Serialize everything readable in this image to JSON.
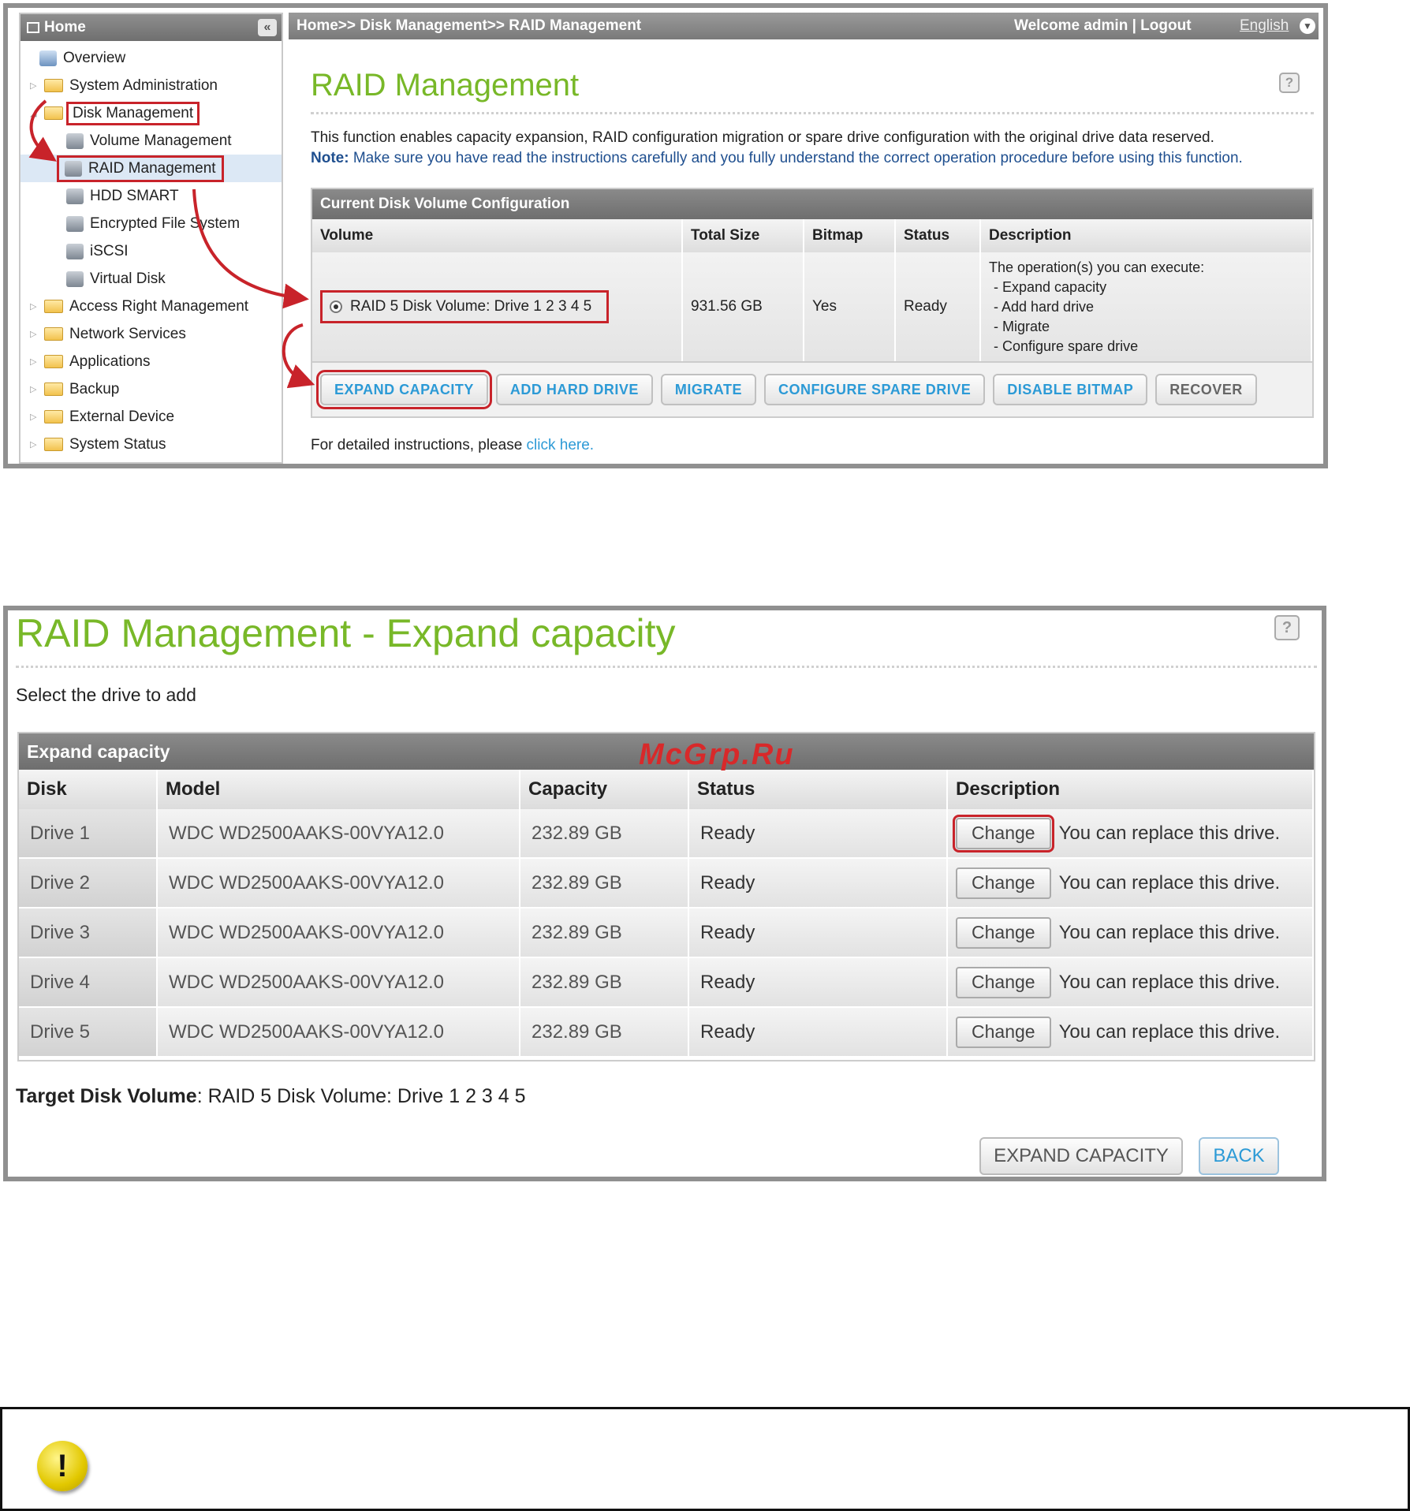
{
  "panel1": {
    "sidebar": {
      "home": "Home",
      "collapse": "«",
      "items": [
        {
          "label": "Overview"
        },
        {
          "label": "System Administration"
        },
        {
          "label": "Disk Management"
        },
        {
          "label": "Volume Management"
        },
        {
          "label": "RAID Management"
        },
        {
          "label": "HDD SMART"
        },
        {
          "label": "Encrypted File System"
        },
        {
          "label": "iSCSI"
        },
        {
          "label": "Virtual Disk"
        },
        {
          "label": "Access Right Management"
        },
        {
          "label": "Network Services"
        },
        {
          "label": "Applications"
        },
        {
          "label": "Backup"
        },
        {
          "label": "External Device"
        },
        {
          "label": "System Status"
        }
      ]
    },
    "header": {
      "breadcrumb": "Home>> Disk Management>> RAID Management",
      "welcome": "Welcome admin | Logout",
      "language": "English"
    },
    "title": "RAID Management",
    "help": "?",
    "description": "This function enables capacity expansion, RAID configuration migration or spare drive configuration with the original drive data reserved.",
    "note_label": "Note:",
    "note_text": " Make sure you have read the instructions carefully and you fully understand the correct operation procedure before using this function.",
    "table": {
      "title": "Current Disk Volume Configuration",
      "columns": [
        "Volume",
        "Total Size",
        "Bitmap",
        "Status",
        "Description"
      ],
      "row": {
        "volume": "RAID 5 Disk Volume: Drive  1 2 3 4 5",
        "total_size": "931.56 GB",
        "bitmap": "Yes",
        "status": "Ready",
        "description": [
          "The operation(s) you can execute:",
          "- Expand capacity",
          "- Add hard drive",
          "- Migrate",
          "- Configure spare drive"
        ]
      }
    },
    "buttons": [
      "EXPAND CAPACITY",
      "ADD HARD DRIVE",
      "MIGRATE",
      "CONFIGURE SPARE DRIVE",
      "DISABLE BITMAP",
      "RECOVER"
    ],
    "footer_text": "For detailed instructions, please ",
    "footer_link": "click here."
  },
  "panel2": {
    "title": "RAID Management - Expand capacity",
    "help": "?",
    "select_label": "Select the drive to add",
    "table": {
      "title": "Expand capacity",
      "columns": [
        "Disk",
        "Model",
        "Capacity",
        "Status",
        "Description"
      ],
      "rows": [
        {
          "disk": "Drive 1",
          "model": "WDC WD2500AAKS-00VYA12.0",
          "capacity": "232.89 GB",
          "status": "Ready",
          "button": "Change",
          "desc": "You can replace this drive."
        },
        {
          "disk": "Drive 2",
          "model": "WDC WD2500AAKS-00VYA12.0",
          "capacity": "232.89 GB",
          "status": "Ready",
          "button": "Change",
          "desc": "You can replace this drive."
        },
        {
          "disk": "Drive 3",
          "model": "WDC WD2500AAKS-00VYA12.0",
          "capacity": "232.89 GB",
          "status": "Ready",
          "button": "Change",
          "desc": "You can replace this drive."
        },
        {
          "disk": "Drive 4",
          "model": "WDC WD2500AAKS-00VYA12.0",
          "capacity": "232.89 GB",
          "status": "Ready",
          "button": "Change",
          "desc": "You can replace this drive."
        },
        {
          "disk": "Drive 5",
          "model": "WDC WD2500AAKS-00VYA12.0",
          "capacity": "232.89 GB",
          "status": "Ready",
          "button": "Change",
          "desc": "You can replace this drive."
        }
      ]
    },
    "target_label": "Target Disk Volume",
    "target_value": ": RAID 5 Disk Volume: Drive  1 2 3 4 5",
    "expand_button": "EXPAND CAPACITY",
    "back_button": "BACK"
  },
  "watermark": "McGrp.Ru",
  "note_icon": "!",
  "colors": {
    "title_green": "#78b828",
    "link_blue": "#2c9ad6",
    "highlight_red": "#c8232a"
  }
}
